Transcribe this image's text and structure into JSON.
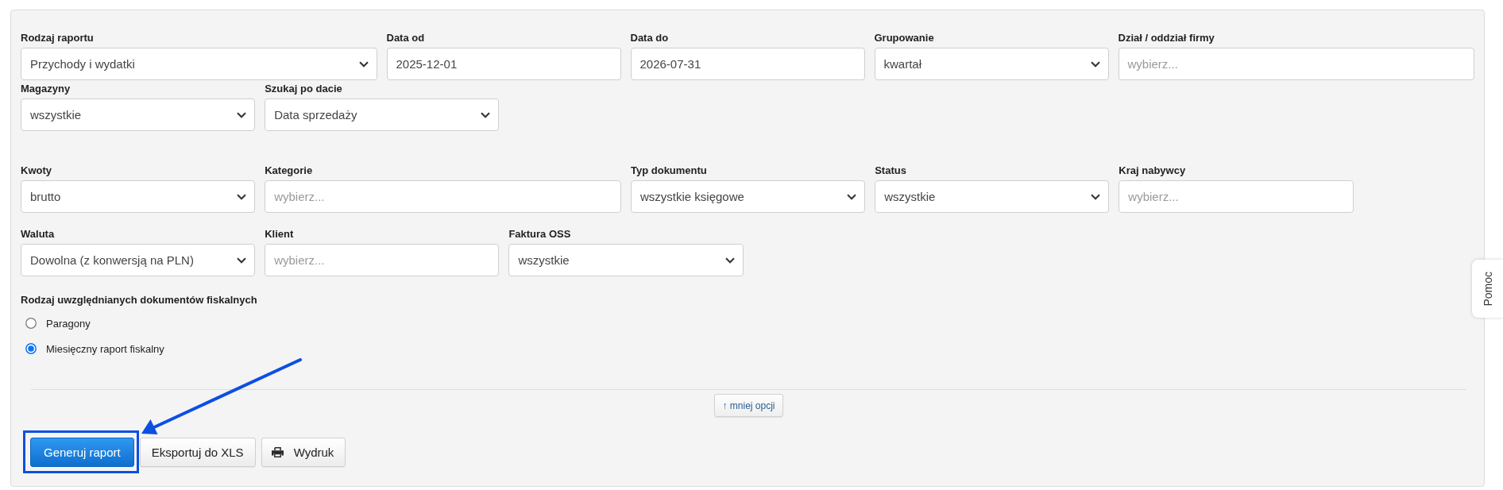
{
  "filter_rows": [
    [
      {
        "label": "Rodzaj raportu",
        "kind": "select",
        "value": "Przychody i wydatki"
      },
      {
        "label": "Data od",
        "kind": "date",
        "value": "2025-12-01"
      },
      {
        "label": "Data do",
        "kind": "date",
        "value": "2026-07-31"
      },
      {
        "label": "Grupowanie",
        "kind": "select",
        "value": "kwartał"
      },
      {
        "label": "Dział / oddział firmy",
        "kind": "multiselect",
        "placeholder": "wybierz..."
      }
    ],
    [
      {
        "label": "Magazyny",
        "kind": "select",
        "value": "wszystkie"
      },
      {
        "label": "Szukaj po dacie",
        "kind": "select",
        "value": "Data sprzedaży"
      }
    ],
    [
      {
        "label": "Kwoty",
        "kind": "select",
        "value": "brutto"
      },
      {
        "label": "Kategorie",
        "kind": "multiselect",
        "placeholder": "wybierz..."
      },
      {
        "label": "Typ dokumentu",
        "kind": "select",
        "value": "wszystkie księgowe"
      },
      {
        "label": "Status",
        "kind": "select",
        "value": "wszystkie"
      },
      {
        "label": "Kraj nabywcy",
        "kind": "multiselect",
        "placeholder": "wybierz..."
      }
    ],
    [
      {
        "label": "Waluta",
        "kind": "select",
        "value": "Dowolna (z konwersją na PLN)"
      },
      {
        "label": "Klient",
        "kind": "multiselect",
        "placeholder": "wybierz..."
      },
      {
        "label": "Faktura OSS",
        "kind": "select",
        "value": "wszystkie"
      }
    ]
  ],
  "fiscal_documents": {
    "label": "Rodzaj uwzględnianych dokumentów fiskalnych",
    "options": [
      {
        "label": "Paragony",
        "selected": false
      },
      {
        "label": "Miesięczny raport fiskalny",
        "selected": true
      }
    ]
  },
  "toggle_options_button": "↑ mniej opcji",
  "actions": [
    {
      "label": "Generuj raport",
      "kind": "primary",
      "highlighted": true
    },
    {
      "label": "Eksportuj do XLS",
      "kind": "default",
      "highlighted": false
    },
    {
      "label": "Wydruk",
      "kind": "print",
      "highlighted": false
    }
  ],
  "help_tab": "Pomoc"
}
